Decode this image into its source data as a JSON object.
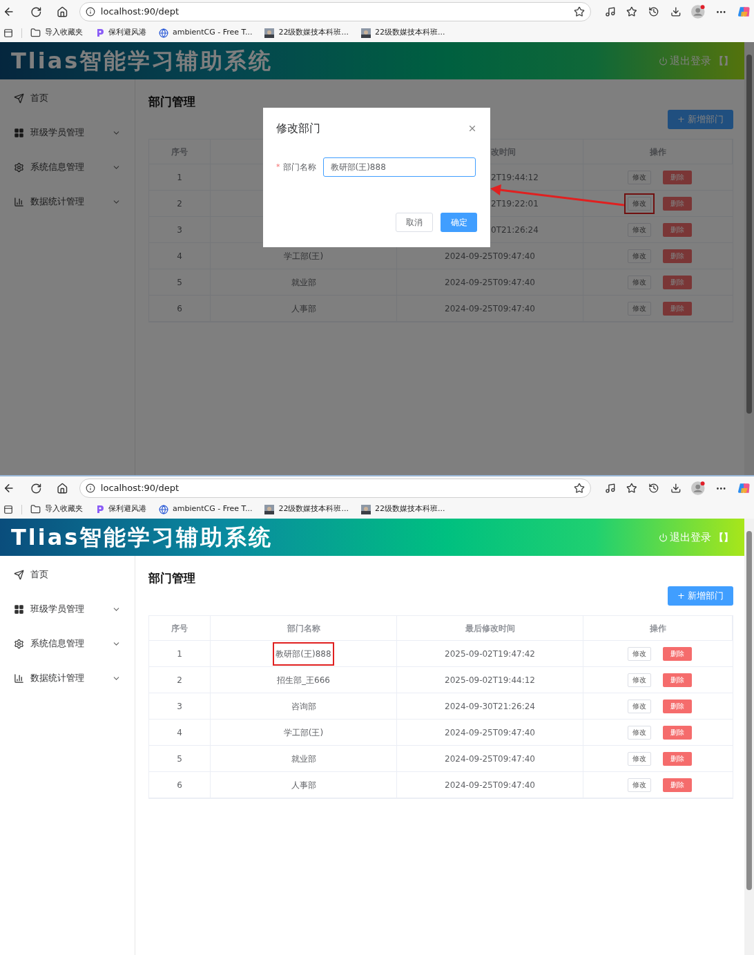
{
  "screens": [
    {
      "browser": {
        "url": "localhost:90/dept",
        "bookmarks": [
          {
            "label": "导入收藏夹",
            "kind": "folder"
          },
          {
            "label": "保利避风港",
            "kind": "site"
          },
          {
            "label": "ambientCG - Free T...",
            "kind": "globe"
          },
          {
            "label": "22级数媒技本科班..."
          },
          {
            "label": "22级数媒技本科班..."
          }
        ]
      },
      "header": {
        "title": "Tlias智能学习辅助系统",
        "logout": "退出登录",
        "bracket": "【】"
      },
      "sidebar": [
        {
          "label": "首页",
          "expandable": false
        },
        {
          "label": "班级学员管理",
          "expandable": true
        },
        {
          "label": "系统信息管理",
          "expandable": true
        },
        {
          "label": "数据统计管理",
          "expandable": true
        }
      ],
      "page_title": "部门管理",
      "add_button": "+ 新增部门",
      "table": {
        "columns": [
          {
            "label": "序号"
          },
          {},
          {
            "label": "改时间"
          },
          {
            "label": "操作"
          }
        ],
        "rows": [
          {
            "index": "1",
            "time": "2T19:44:12",
            "edit": "修改",
            "delete": "删除"
          },
          {
            "index": "2",
            "time": "2T19:22:01",
            "edit": "修改",
            "delete": "删除",
            "edit_marked": true
          },
          {
            "index": "3",
            "time": "0T21:26:24",
            "edit": "修改",
            "delete": "删除"
          },
          {
            "index": "4",
            "name": "学工部(王)",
            "time": "2024-09-25T09:47:40",
            "edit": "修改",
            "delete": "删除"
          },
          {
            "index": "5",
            "name": "就业部",
            "time": "2024-09-25T09:47:40",
            "edit": "修改",
            "delete": "删除"
          },
          {
            "index": "6",
            "name": "人事部",
            "time": "2024-09-25T09:47:40",
            "edit": "修改",
            "delete": "删除"
          }
        ]
      },
      "dialog": {
        "title": "修改部门",
        "required_mark": "*",
        "field_label": "部门名称",
        "value": "教研部(王)888",
        "cancel": "取消",
        "confirm": "确定"
      }
    },
    {
      "browser": {
        "url": "localhost:90/dept",
        "bookmarks": [
          {
            "label": "导入收藏夹",
            "kind": "folder"
          },
          {
            "label": "保利避风港",
            "kind": "site"
          },
          {
            "label": "ambientCG - Free T...",
            "kind": "globe"
          },
          {
            "label": "22级数媒技本科班..."
          },
          {
            "label": "22级数媒技本科班..."
          }
        ]
      },
      "header": {
        "title": "Tlias智能学习辅助系统",
        "logout": "退出登录",
        "bracket": "【】"
      },
      "sidebar": [
        {
          "label": "首页",
          "expandable": false
        },
        {
          "label": "班级学员管理",
          "expandable": true
        },
        {
          "label": "系统信息管理",
          "expandable": true
        },
        {
          "label": "数据统计管理",
          "expandable": true
        }
      ],
      "page_title": "部门管理",
      "add_button": "+ 新增部门",
      "table": {
        "columns": [
          {
            "label": "序号"
          },
          {
            "label": "部门名称"
          },
          {
            "label": "最后修改时间"
          },
          {
            "label": "操作"
          }
        ],
        "rows": [
          {
            "index": "1",
            "name": "教研部(王)888",
            "time": "2025-09-02T19:47:42",
            "edit": "修改",
            "delete": "删除",
            "name_marked": true
          },
          {
            "index": "2",
            "name": "招生部_王666",
            "time": "2025-09-02T19:44:12",
            "edit": "修改",
            "delete": "删除"
          },
          {
            "index": "3",
            "name": "咨询部",
            "time": "2024-09-30T21:26:24",
            "edit": "修改",
            "delete": "删除"
          },
          {
            "index": "4",
            "name": "学工部(王)",
            "time": "2024-09-25T09:47:40",
            "edit": "修改",
            "delete": "删除"
          },
          {
            "index": "5",
            "name": "就业部",
            "time": "2024-09-25T09:47:40",
            "edit": "修改",
            "delete": "删除"
          },
          {
            "index": "6",
            "name": "人事部",
            "time": "2024-09-25T09:47:40",
            "edit": "修改",
            "delete": "删除"
          }
        ]
      }
    }
  ]
}
